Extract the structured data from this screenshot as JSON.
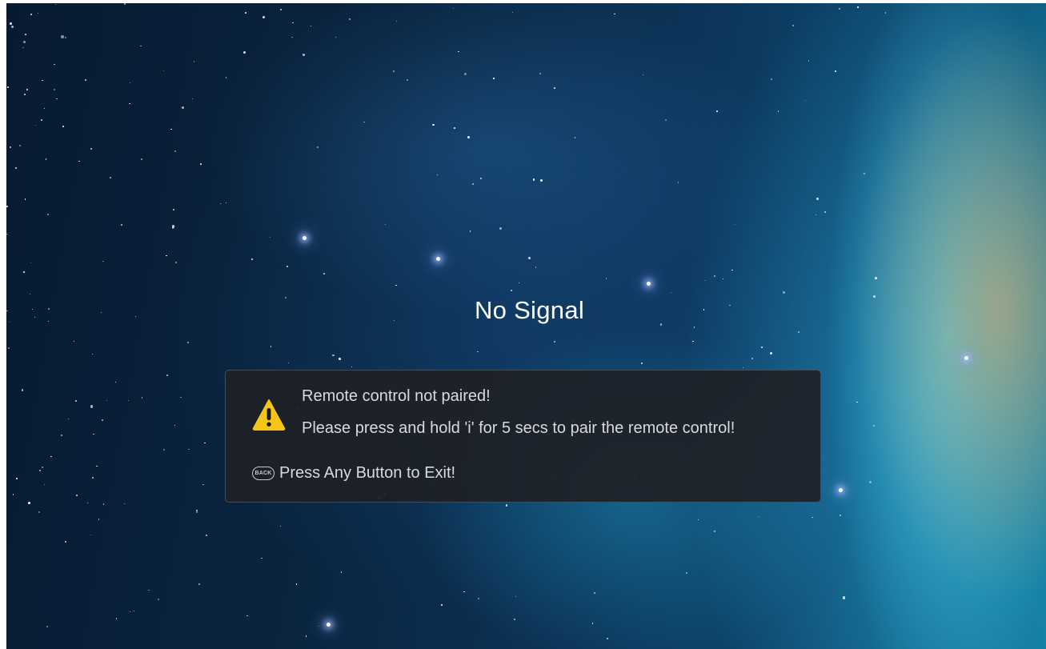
{
  "screen": {
    "status_title": "No Signal"
  },
  "dialog": {
    "icon": "warning-triangle-icon",
    "message_line1": "Remote control not paired!",
    "message_line2": "Please press and hold 'i' for 5 secs to pair the remote control!",
    "back_button_label": "BACK",
    "exit_hint": "Press Any Button to Exit!"
  },
  "colors": {
    "warning_fill": "#f5c518",
    "dialog_background": "#1e2126"
  }
}
